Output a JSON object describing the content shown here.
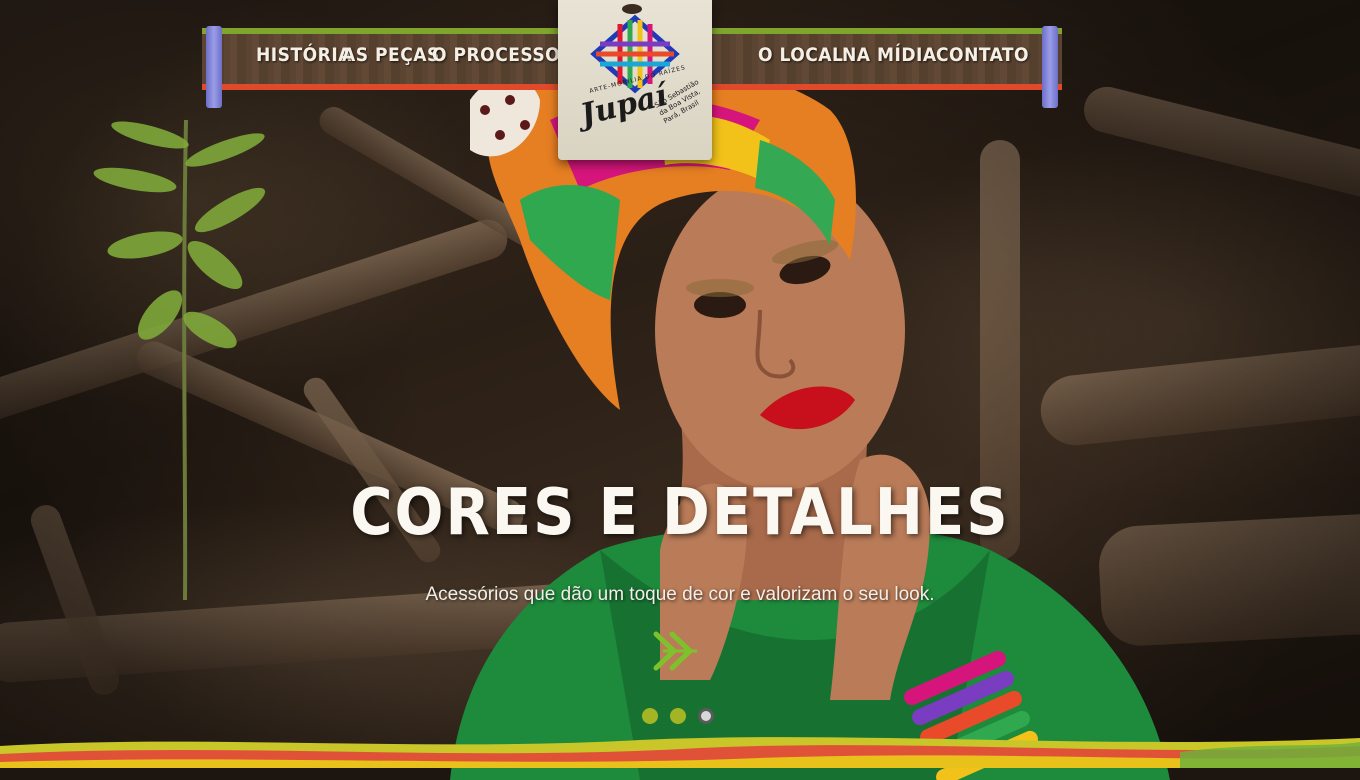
{
  "nav": {
    "left": [
      "HISTÓRIA",
      "AS PEÇAS",
      "O PROCESSO"
    ],
    "right": [
      "O LOCAL",
      "NA MÍDIA",
      "CONTATO"
    ],
    "colors": {
      "top_stripe": "#7fa52d",
      "bottom_stripe": "#e04a2a",
      "caps": "#8385d6"
    }
  },
  "logo": {
    "name": "Jupaí",
    "tagline": "ARTE-MOBILIA DO RAÍZES",
    "location": "São Sebastião da Boa Vista, Pará, Brasil"
  },
  "hero": {
    "title": "CORES E DETALHES",
    "subtitle": "Acessórios que dão um toque de cor e valorizam o seu look.",
    "next_icon": "double-chevron-right-icon",
    "accent_color": "#7ec22b"
  },
  "slider": {
    "dots": 3,
    "active_index": 2
  }
}
